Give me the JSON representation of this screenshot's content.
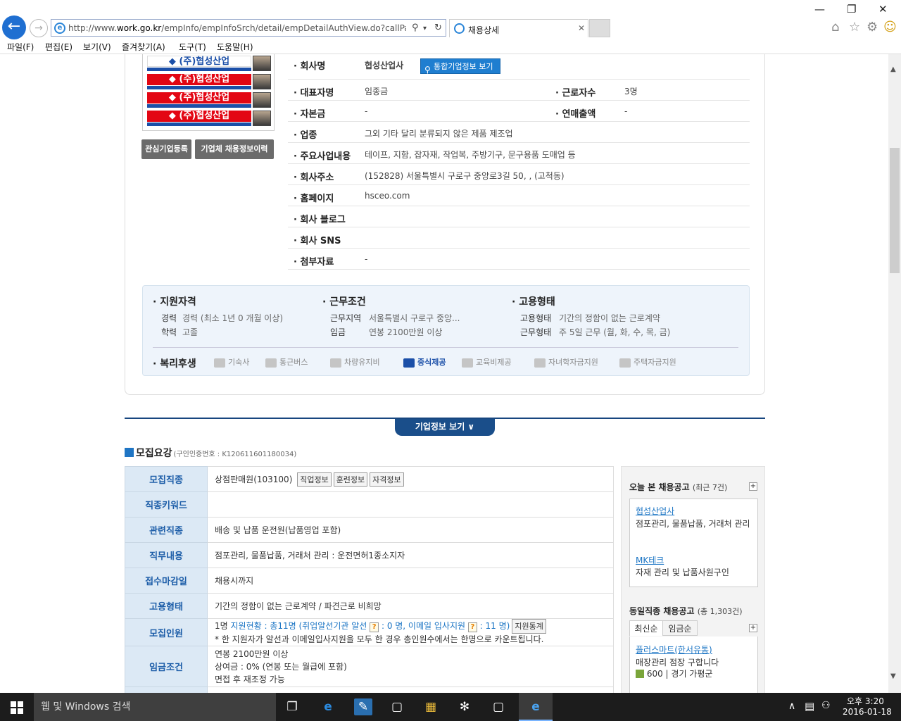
{
  "browser": {
    "url_prefix": "http://www.",
    "url_domain": "work.go.kr",
    "url_path": "/empInfo/empInfoSrch/detail/empDetailAuthView.do?callPage=det",
    "tab_title": "채용상세",
    "menu": [
      "파일(F)",
      "편집(E)",
      "보기(V)",
      "즐겨찾기(A)",
      "도구(T)",
      "도움말(H)"
    ]
  },
  "company": {
    "logo_text": "(주)협성산업",
    "buttons": {
      "interest": "관심기업등록",
      "history": "기업체 채용정보이력"
    },
    "name_label": "회사명",
    "name": "협성산업사",
    "integrated_btn": "통합기업정보 보기",
    "fields": [
      {
        "label": "대표자명",
        "value": "임종금",
        "label2": "근로자수",
        "value2": "3명"
      },
      {
        "label": "자본금",
        "value": "-",
        "label2": "연매출액",
        "value2": "-"
      },
      {
        "label": "업종",
        "value": "그외 기타 달리 분류되지 않은 제품 제조업"
      },
      {
        "label": "주요사업내용",
        "value": "테이프, 지함, 잡자재, 작업복, 주방기구, 문구용품 도매업 등"
      },
      {
        "label": "회사주소",
        "value": "(152828) 서울특별시 구로구 중앙로3길 50, , (고척동)"
      },
      {
        "label": "홈페이지",
        "value": "hsceo.com"
      },
      {
        "label": "회사 블로그",
        "value": ""
      },
      {
        "label": "회사 SNS",
        "value": ""
      },
      {
        "label": "첨부자료",
        "value": "-"
      }
    ]
  },
  "conditions": {
    "qual_title": "지원자격",
    "career_label": "경력",
    "career_value": "경력 (최소 1년 0 개월 이상)",
    "edu_label": "학력",
    "edu_value": "고졸",
    "work_title": "근무조건",
    "area_label": "근무지역",
    "area_value": "서울특별시 구로구 중앙...",
    "wage_label": "임금",
    "wage_value": "연봉 2100만원 이상",
    "emp_title": "고용형태",
    "type_label": "고용형태",
    "type_value": "기간의 정함이 없는 근로계약",
    "hours_label": "근무형태",
    "hours_value": "주 5일 근무 (월, 화, 수, 목, 금)",
    "welfare_title": "복리후생",
    "welfare": [
      {
        "label": "기숙사",
        "active": false
      },
      {
        "label": "통근버스",
        "active": false
      },
      {
        "label": "차량유지비",
        "active": false
      },
      {
        "label": "중식제공",
        "active": true
      },
      {
        "label": "교육비제공",
        "active": false
      },
      {
        "label": "자녀학자금지원",
        "active": false
      },
      {
        "label": "주택자금지원",
        "active": false
      }
    ]
  },
  "expand_label": "기업정보 보기",
  "recruit": {
    "title": "모집요강",
    "sub": "(구인인증번호 : K120611601180034)",
    "rows": {
      "job_label": "모집직종",
      "job_value": "상점판매원(103100)",
      "job_tags": [
        "직업정보",
        "훈련정보",
        "자격정보"
      ],
      "keyword_label": "직종키워드",
      "related_label": "관련직종",
      "related_value": "배송 및 납품 운전원(납품영업 포함)",
      "duty_label": "직무내용",
      "duty_value": "점포관리, 물품납품, 거래처 관리 : 운전면허1종소지자",
      "deadline_label": "접수마감일",
      "deadline_value": "채용시까지",
      "emptype_label": "고용형태",
      "emptype_value": "기간의 정함이 없는 근로계약 / 파견근로 비희망",
      "count_label": "모집인원",
      "count_a": "1명 ",
      "count_b": "지원현황 : 총11명 (취업알선기관 알선 ",
      "count_c": " : 0 명, 이메일 입사지원 ",
      "count_d": " : 11 명)",
      "count_btn": "지원통계",
      "count_note": "* 한 지원자가 알선과 이메일입사지원을 모두 한 경우 총인원수에서는 한명으로 카운트됩니다.",
      "wage_label": "임금조건",
      "wage_1": "연봉 2100만원 이상",
      "wage_2": "상여금 : 0% (연봉 또는 월급에 포함)",
      "wage_3": "면접 후 재조정 가능"
    }
  },
  "sidebar": {
    "recent_title": "오늘 본 채용공고",
    "recent_count": "(최근 7건)",
    "recent": [
      {
        "name": "협성산업사",
        "desc": "점포관리, 물품납품, 거래처 관리"
      },
      {
        "name": "MK테크",
        "desc": "자재 관리 및 납품사원구인"
      }
    ],
    "same_title": "동일직종 채용공고",
    "same_count": "(총 1,303건)",
    "tabs": [
      "최신순",
      "임금순"
    ],
    "same_item": {
      "name": "플러스마트(한서유통)",
      "desc": "매장관리 점장 구합니다",
      "meta": "600 | 경기 가평군"
    }
  },
  "taskbar": {
    "search": "웹 및 Windows 검색",
    "ampm": "오후 3:20",
    "date": "2016-01-18"
  }
}
